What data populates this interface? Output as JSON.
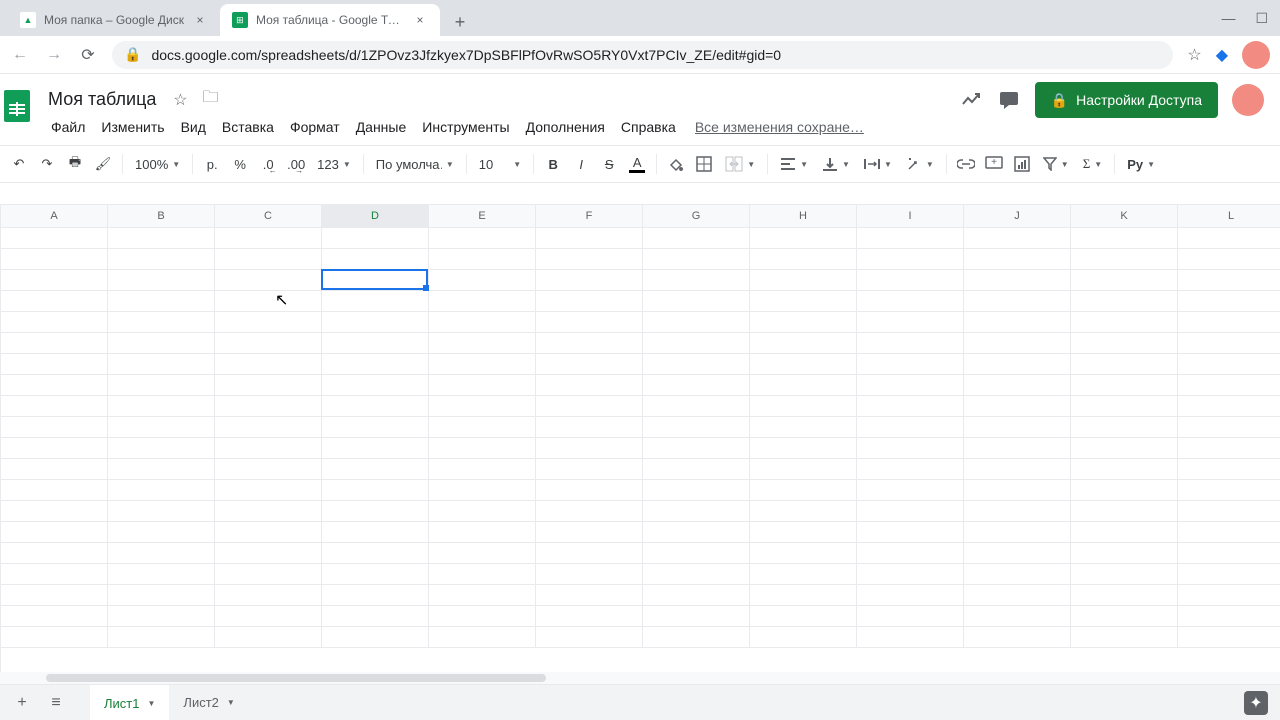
{
  "browser": {
    "tabs": [
      {
        "title": "Моя папка – Google Диск",
        "active": false
      },
      {
        "title": "Моя таблица - Google Таблицы",
        "active": true
      }
    ],
    "url": "docs.google.com/spreadsheets/d/1ZPOvz3Jfzkyex7DpSBFlPfOvRwSO5RY0Vxt7PCIv_ZE/edit#gid=0"
  },
  "doc": {
    "title": "Моя таблица",
    "save_status": "Все изменения сохране…"
  },
  "menus": [
    "Файл",
    "Изменить",
    "Вид",
    "Вставка",
    "Формат",
    "Данные",
    "Инструменты",
    "Дополнения",
    "Справка"
  ],
  "toolbar": {
    "zoom": "100%",
    "currency": "р.",
    "percent": "%",
    "dec_less": ".0",
    "dec_more": ".00",
    "num_format": "123",
    "font": "По умолча…",
    "font_size": "10",
    "addon": "Py"
  },
  "share": {
    "label": "Настройки Доступа"
  },
  "columns": [
    "A",
    "B",
    "C",
    "D",
    "E",
    "F",
    "G",
    "H",
    "I",
    "J",
    "K",
    "L"
  ],
  "selected_col_index": 3,
  "row_count": 20,
  "selection": {
    "col": 3,
    "row": 2
  },
  "sheets": [
    {
      "name": "Лист1",
      "active": true
    },
    {
      "name": "Лист2",
      "active": false
    }
  ]
}
